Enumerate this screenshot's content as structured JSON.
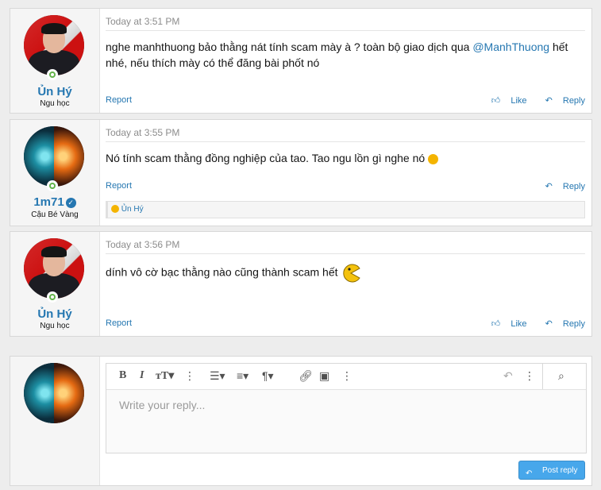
{
  "posts": [
    {
      "author": "Ủn Hý",
      "title": "Ngu học",
      "avatar": "kim-avatar",
      "time": "Today at 3:51 PM",
      "message_pre": "nghe manhthuong bảo thằng nát tính scam mày à ? toàn bộ giao dịch qua ",
      "mention": "@ManhThuong",
      "message_post": " hết nhé, nếu thích mày có thể đăng bài phốt nó",
      "report": "Report",
      "like": "Like",
      "reply": "Reply"
    },
    {
      "author": "1m71",
      "title": "Cậu Bé Vàng",
      "avatar": "phoenix-avatar",
      "verified": true,
      "time": "Today at 3:55 PM",
      "message": "Nó tính scam thằng đồng nghiệp của tao. Tao ngu lồn gì nghe nó",
      "report": "Report",
      "reply": "Reply",
      "reaction_user": "Ủn Hý"
    },
    {
      "author": "Ủn Hý",
      "title": "Ngu học",
      "avatar": "kim-avatar",
      "time": "Today at 3:56 PM",
      "message": "dính vô cờ bạc thằng nào cũng thành scam hết",
      "report": "Report",
      "like": "Like",
      "reply": "Reply"
    }
  ],
  "reply_box": {
    "placeholder": "Write your reply...",
    "post_reply": "Post reply"
  },
  "colors": {
    "link": "#2577b1",
    "button": "#47a7eb",
    "online": "#63b34a"
  }
}
